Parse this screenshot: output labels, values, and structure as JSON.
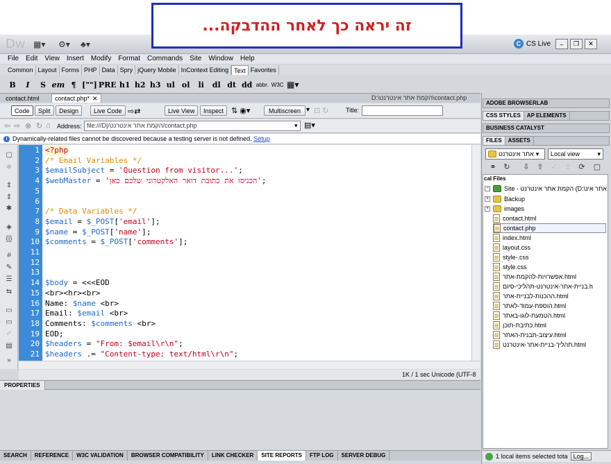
{
  "banner": {
    "text": "זה יראה כך לאחר ההדבקה..."
  },
  "app": {
    "logo": "Dw",
    "cs_live": "CS Live",
    "menu": [
      "File",
      "Edit",
      "View",
      "Insert",
      "Modify",
      "Format",
      "Commands",
      "Site",
      "Window",
      "Help"
    ],
    "insert_tabs": [
      "Common",
      "Layout",
      "Forms",
      "PHP",
      "Data",
      "Spry",
      "jQuery Mobile",
      "InContext Editing",
      "Text",
      "Favorites"
    ],
    "active_insert_tab": "Text",
    "text_buttons": [
      "B",
      "I",
      "S",
      "em",
      "¶",
      "[\"\"]",
      "PRE",
      "h1",
      "h2",
      "h3",
      "ul",
      "ol",
      "li",
      "dl",
      "dt",
      "dd",
      "abbr.",
      "W3C"
    ]
  },
  "document": {
    "tabs": [
      "contact.html",
      "contact.php*"
    ],
    "path": "D:\\הקמת אתר אינטרנט\\contact.php",
    "view_buttons": [
      "Code",
      "Split",
      "Design",
      "Live Code",
      "Live View",
      "Inspect",
      "Multiscreen"
    ],
    "active_view": "Code",
    "title_label": "Title:",
    "title_value": "",
    "address_label": "Address:",
    "address_value": "file:///D|/הקמת אתר אינטרנט/contact.php",
    "info_text": "Dynamically-related files cannot be discovered because a testing server is not defined.",
    "info_link": "Setup",
    "line_numbers": [
      "1",
      "2",
      "3",
      "4",
      "5",
      "6",
      "7",
      "8",
      "9",
      "10",
      "11",
      "12",
      "13",
      "14",
      "15",
      "16",
      "17",
      "18",
      "19",
      "20",
      "21"
    ],
    "code_lines": [
      "<?php",
      "/* Email Variables */",
      "$emailSubject = 'Question from visitor...';",
      "$webMaster = 'הכניסו את כתובת דואר האלקטרוני שלכם כאן';",
      "",
      "",
      "/* Data Variables */",
      "$email = $_POST['email'];",
      "$name = $_POST['name'];",
      "$comments = $_POST['comments'];",
      "",
      "",
      "",
      "$body = <<<EOD",
      "<br><hr><br>",
      "Name: $name <br>",
      "Email: $email <br>",
      "Comments: $comments <br>",
      "EOD;",
      "$headers = \"From: $email\\r\\n\";",
      "$headers .= \"Content-type: text/html\\r\\n\";"
    ],
    "status": "1K / 1 sec  Unicode (UTF-8"
  },
  "panels": {
    "properties": "PROPERTIES",
    "bottom_tabs": [
      "SEARCH",
      "REFERENCE",
      "W3C VALIDATION",
      "BROWSER COMPATIBILITY",
      "LINK CHECKER",
      "SITE REPORTS",
      "FTP LOG",
      "SERVER DEBUG"
    ],
    "active_bottom_tab": "SITE REPORTS",
    "browserlab": "ADOBE BROWSERLAB",
    "css_styles": "CSS STYLES",
    "ap_elements": "AP ELEMENTS",
    "business_catalyst": "BUSINESS CATALYST",
    "files": "FILES",
    "assets": "ASSETS",
    "site_select": "אתר אינטרנט",
    "view_select": "Local view",
    "local_files": "cal Files",
    "site_root": "Site - הקמת אתר אינטרנט (D:\\הקמת אתר אינ",
    "folders": [
      "Backup",
      "images"
    ],
    "files_list": [
      "contact.html",
      "contact.php",
      "index.html",
      "layout.css",
      "style-.css",
      "style.css",
      "אפשרויות-להקמת-אתר.html",
      "בניית-אתר-אינטרנט-תהליכי-סיום.h",
      "ההכנות-לבניית-אתר.html",
      "הוספת-עמוד-לאתר.html",
      "הטמעת-לוגו-באתר.html",
      "כתיבת-תוכן.html",
      "עיצוב-תבנית-האתר.html",
      "תהליך-בניית-אתר-אינטרנט.html"
    ],
    "selected_file": "contact.php",
    "status": "1 local items selected tota",
    "log_button": "Log..."
  }
}
